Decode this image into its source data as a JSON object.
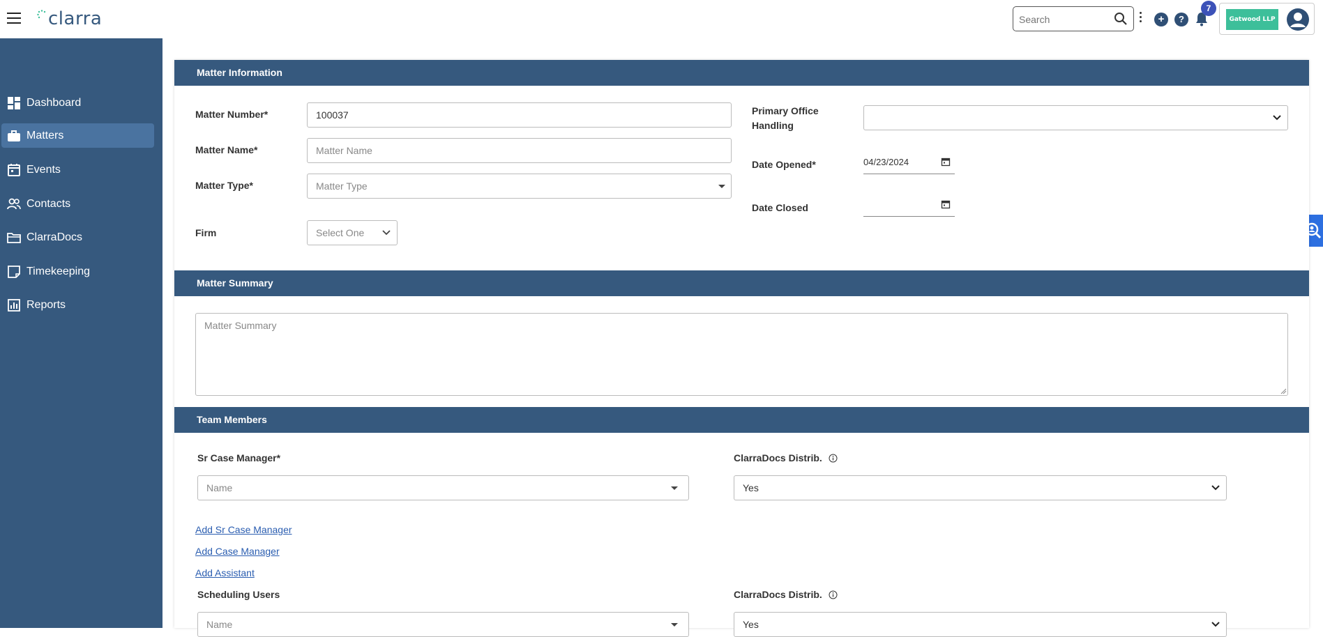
{
  "app": {
    "logo_text": "clarra"
  },
  "header": {
    "search_placeholder": "Search",
    "notification_count": "7",
    "firm_logo_text": "Gatwood LLP",
    "help_label": "?",
    "plus_label": "+"
  },
  "sidebar": {
    "items": [
      {
        "label": "Dashboard",
        "icon": "dashboard-icon"
      },
      {
        "label": "Matters",
        "icon": "briefcase-icon",
        "active": true
      },
      {
        "label": "Events",
        "icon": "calendar-icon"
      },
      {
        "label": "Contacts",
        "icon": "contacts-icon"
      },
      {
        "label": "ClarraDocs",
        "icon": "folder-icon"
      },
      {
        "label": "Timekeeping",
        "icon": "note-icon"
      },
      {
        "label": "Reports",
        "icon": "reports-icon"
      }
    ]
  },
  "matter_information": {
    "title": "Matter Information",
    "matter_number_label": "Matter Number*",
    "matter_number_value": "100037",
    "matter_name_label": "Matter Name*",
    "matter_name_placeholder": "Matter Name",
    "matter_type_label": "Matter Type*",
    "matter_type_placeholder": "Matter Type",
    "firm_label": "Firm",
    "firm_value": "Select One",
    "primary_office_label_line1": "Primary Office",
    "primary_office_label_line2": "Handling",
    "primary_office_value": "",
    "date_opened_label": "Date Opened*",
    "date_opened_value": "04/23/2024",
    "date_closed_label": "Date Closed",
    "date_closed_value": ""
  },
  "matter_summary": {
    "title": "Matter Summary",
    "placeholder": "Matter Summary"
  },
  "team_members": {
    "title": "Team Members",
    "sr_case_manager_label": "Sr Case Manager*",
    "sr_case_manager_placeholder": "Name",
    "distrib_label": "ClarraDocs Distrib.",
    "distrib_value": "Yes",
    "add_sr_case_manager": "Add Sr Case Manager",
    "add_case_manager": "Add Case Manager",
    "add_assistant": "Add Assistant",
    "scheduling_users_label": "Scheduling Users",
    "scheduling_users_placeholder": "Name",
    "distrib2_label": "ClarraDocs Distrib.",
    "distrib2_value": "Yes"
  },
  "colors": {
    "sidebar_bg": "#36597e",
    "active_item": "#4a73a0",
    "section_header": "#36597e",
    "link": "#2a5db0",
    "badge": "#3c52b8",
    "firm_logo": "#3dbf9a"
  }
}
